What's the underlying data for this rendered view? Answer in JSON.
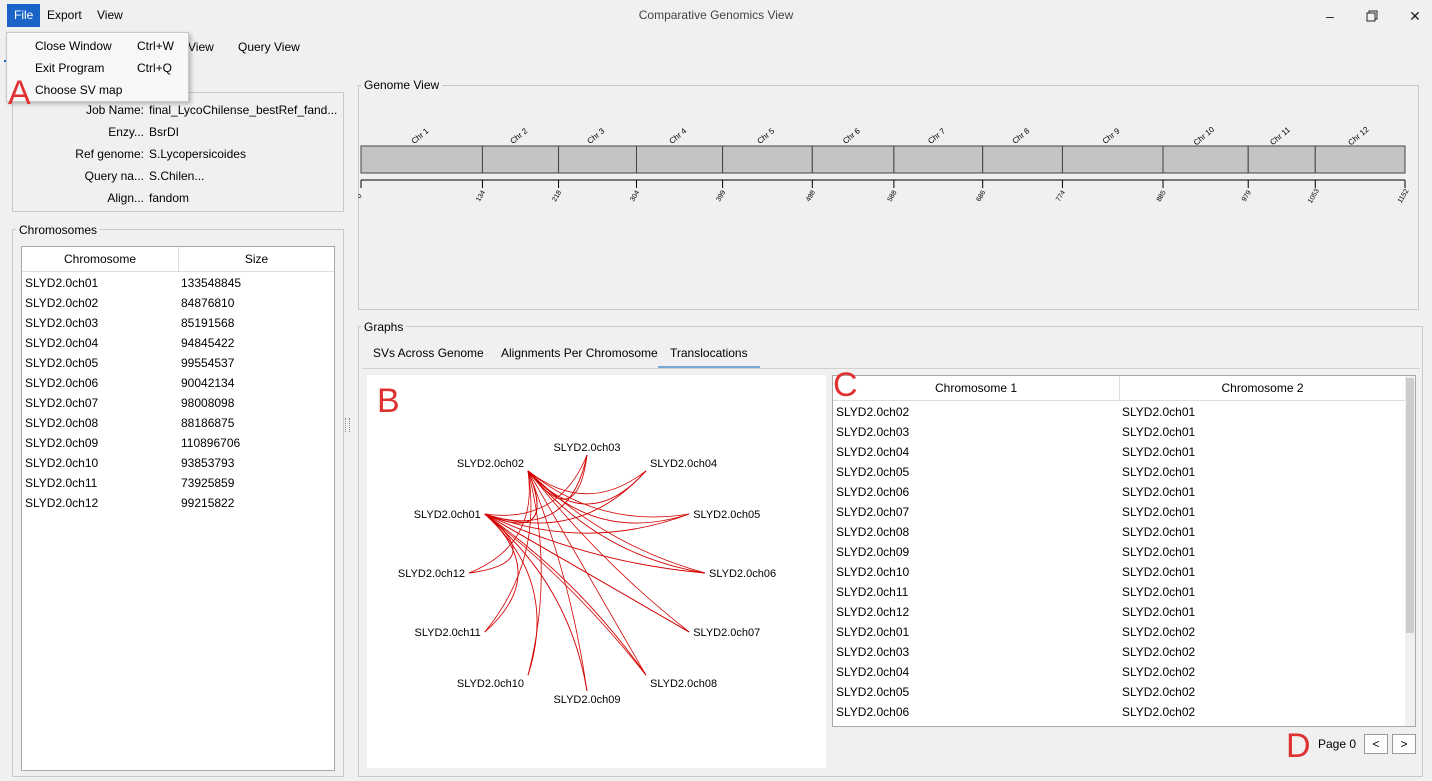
{
  "window": {
    "title": "Comparative Genomics View",
    "minimize_icon": "minimize-icon",
    "maximize_icon": "maximize-icon",
    "close_icon": "close-icon"
  },
  "menu": {
    "file": "File",
    "export": "Export",
    "view": "View"
  },
  "file_menu": [
    {
      "label": "Close Window",
      "shortcut": "Ctrl+W"
    },
    {
      "label": "Exit Program",
      "shortcut": "Ctrl+Q"
    },
    {
      "label": "Choose SV map",
      "shortcut": ""
    }
  ],
  "top_tabs": {
    "view_partial": "View",
    "query_view": "Query View"
  },
  "job_info": [
    {
      "label": "Job Name:",
      "value": "final_LycoChilense_bestRef_fand..."
    },
    {
      "label": "Enzy...",
      "value": "BsrDI"
    },
    {
      "label": "Ref genome:",
      "value": "S.Lycopersicoides"
    },
    {
      "label": "Query na...",
      "value": "S.Chilen..."
    },
    {
      "label": "Align...",
      "value": "fandom"
    }
  ],
  "chromosomes": {
    "title": "Chromosomes",
    "headers": [
      "Chromosome",
      "Size"
    ],
    "rows": [
      [
        "SLYD2.0ch01",
        "133548845"
      ],
      [
        "SLYD2.0ch02",
        "84876810"
      ],
      [
        "SLYD2.0ch03",
        "85191568"
      ],
      [
        "SLYD2.0ch04",
        "94845422"
      ],
      [
        "SLYD2.0ch05",
        "99554537"
      ],
      [
        "SLYD2.0ch06",
        "90042134"
      ],
      [
        "SLYD2.0ch07",
        "98008098"
      ],
      [
        "SLYD2.0ch08",
        "88186875"
      ],
      [
        "SLYD2.0ch09",
        "110896706"
      ],
      [
        "SLYD2.0ch10",
        "93853793"
      ],
      [
        "SLYD2.0ch11",
        "73925859"
      ],
      [
        "SLYD2.0ch12",
        "99215822"
      ]
    ]
  },
  "genome_view": {
    "title": "Genome View",
    "chromosomes": [
      "Chr 1",
      "Chr 2",
      "Chr 3",
      "Chr 4",
      "Chr 5",
      "Chr 6",
      "Chr 7",
      "Chr 8",
      "Chr 9",
      "Chr 10",
      "Chr 11",
      "Chr 12"
    ],
    "ticks": [
      "0",
      "134",
      "218",
      "304",
      "399",
      "498",
      "588",
      "686",
      "774",
      "885",
      "979",
      "1053",
      "1152"
    ]
  },
  "graphs": {
    "title": "Graphs",
    "tabs": [
      "SVs Across Genome",
      "Alignments Per Chromosome",
      "Translocations"
    ],
    "selected_tab": "Translocations"
  },
  "circos": {
    "nodes": [
      "SLYD2.0ch01",
      "SLYD2.0ch02",
      "SLYD2.0ch03",
      "SLYD2.0ch04",
      "SLYD2.0ch05",
      "SLYD2.0ch06",
      "SLYD2.0ch07",
      "SLYD2.0ch08",
      "SLYD2.0ch09",
      "SLYD2.0ch10",
      "SLYD2.0ch11",
      "SLYD2.0ch12"
    ],
    "link_color": "#d40000"
  },
  "translocations": {
    "headers": [
      "Chromosome 1",
      "Chromosome 2"
    ],
    "rows": [
      [
        "SLYD2.0ch02",
        "SLYD2.0ch01"
      ],
      [
        "SLYD2.0ch03",
        "SLYD2.0ch01"
      ],
      [
        "SLYD2.0ch04",
        "SLYD2.0ch01"
      ],
      [
        "SLYD2.0ch05",
        "SLYD2.0ch01"
      ],
      [
        "SLYD2.0ch06",
        "SLYD2.0ch01"
      ],
      [
        "SLYD2.0ch07",
        "SLYD2.0ch01"
      ],
      [
        "SLYD2.0ch08",
        "SLYD2.0ch01"
      ],
      [
        "SLYD2.0ch09",
        "SLYD2.0ch01"
      ],
      [
        "SLYD2.0ch10",
        "SLYD2.0ch01"
      ],
      [
        "SLYD2.0ch11",
        "SLYD2.0ch01"
      ],
      [
        "SLYD2.0ch12",
        "SLYD2.0ch01"
      ],
      [
        "SLYD2.0ch01",
        "SLYD2.0ch02"
      ],
      [
        "SLYD2.0ch03",
        "SLYD2.0ch02"
      ],
      [
        "SLYD2.0ch04",
        "SLYD2.0ch02"
      ],
      [
        "SLYD2.0ch05",
        "SLYD2.0ch02"
      ],
      [
        "SLYD2.0ch06",
        "SLYD2.0ch02"
      ]
    ]
  },
  "pager": {
    "label": "Page 0",
    "prev": "<",
    "next": ">"
  },
  "annotations": {
    "a": "A",
    "b": "B",
    "c": "C",
    "d": "D",
    "color": "#e03131"
  }
}
